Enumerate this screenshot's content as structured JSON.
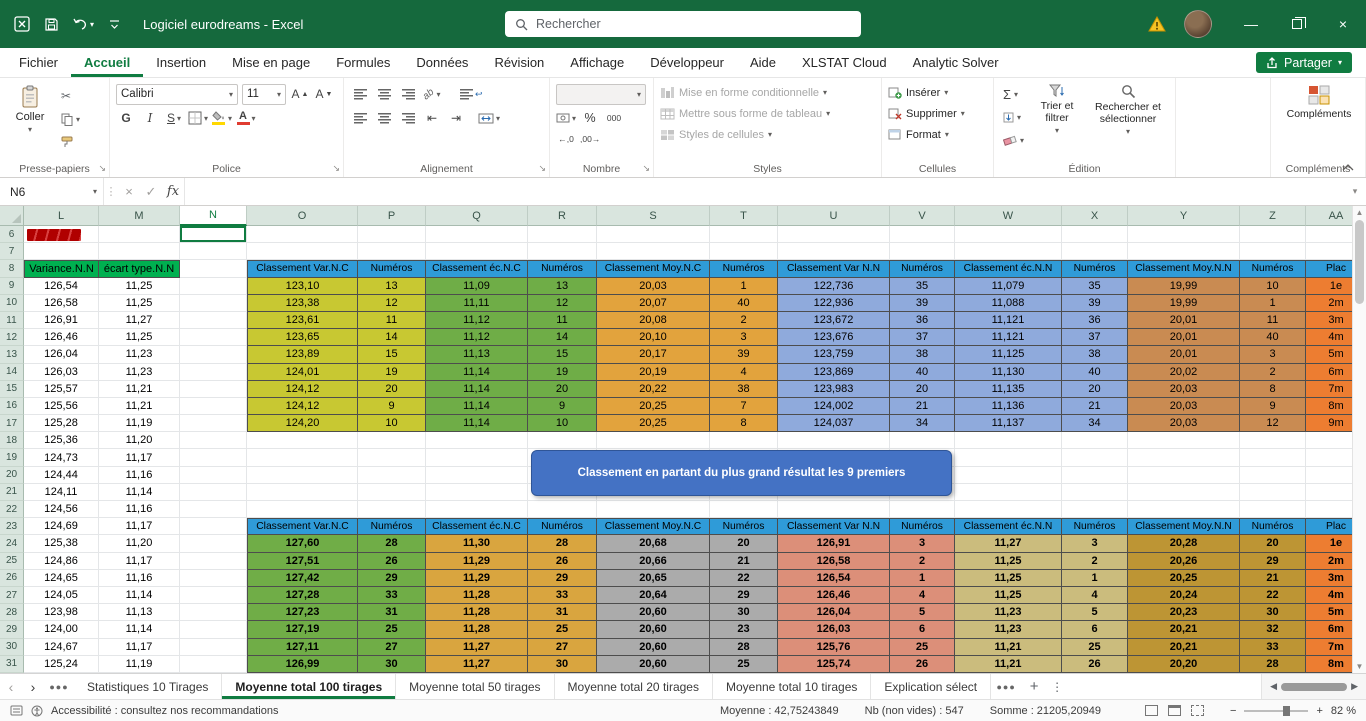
{
  "colors": {
    "titlebar": "#15693D",
    "accent": "#107C41",
    "hdr": "#D9E5DE",
    "header_blue": "#2F9BD8",
    "lm_green": "#00B050",
    "banner": "#4472C4",
    "banner_border": "#2F5597"
  },
  "title_bar": {
    "title": "Logiciel eurodreams -  Excel",
    "search_placeholder": "Rechercher"
  },
  "ribbon_tabs": [
    "Fichier",
    "Accueil",
    "Insertion",
    "Mise en page",
    "Formules",
    "Données",
    "Révision",
    "Affichage",
    "Développeur",
    "Aide",
    "XLSTAT Cloud",
    "Analytic Solver"
  ],
  "active_tab_index": 1,
  "share_label": "Partager",
  "ribbon": {
    "paste_label": "Coller",
    "font_name": "Calibri",
    "font_size": "11",
    "bold_label": "G",
    "italic_label": "I",
    "underline_label": "S",
    "percent_label": "%",
    "thousands_label": "000",
    "dec_inc_label": "←,0",
    "dec_dec_label": ",00→",
    "styles_items": [
      "Mise en forme conditionnelle",
      "Mettre sous forme de tableau",
      "Styles de cellules"
    ],
    "cells_items": [
      "Insérer",
      "Supprimer",
      "Format"
    ],
    "sort_filter_label": "Trier et filtrer",
    "find_select_label": "Rechercher et sélectionner",
    "addins_label": "Compléments",
    "groups": [
      "Presse-papiers",
      "Police",
      "Alignement",
      "Nombre",
      "Styles",
      "Cellules",
      "Édition",
      "Compléments"
    ]
  },
  "formula_bar": {
    "name_box": "N6",
    "fx": "fx",
    "content": ""
  },
  "sheet": {
    "columns": [
      "L",
      "M",
      "N",
      "O",
      "P",
      "Q",
      "R",
      "S",
      "T",
      "U",
      "V",
      "W",
      "X",
      "Y",
      "Z",
      "AA"
    ],
    "first_row": 6,
    "last_row": 31,
    "selected": {
      "row": 6,
      "col": "N"
    },
    "lm_header": [
      "Variance.N.N",
      "écart type.N.N"
    ],
    "lm_rows": {
      "9": [
        "126,54",
        "11,25"
      ],
      "10": [
        "126,58",
        "11,25"
      ],
      "11": [
        "126,91",
        "11,27"
      ],
      "12": [
        "126,46",
        "11,25"
      ],
      "13": [
        "126,04",
        "11,23"
      ],
      "14": [
        "126,03",
        "11,23"
      ],
      "15": [
        "125,57",
        "11,21"
      ],
      "16": [
        "125,56",
        "11,21"
      ],
      "17": [
        "125,28",
        "11,19"
      ],
      "18": [
        "125,36",
        "11,20"
      ],
      "19": [
        "124,73",
        "11,17"
      ],
      "20": [
        "124,44",
        "11,16"
      ],
      "21": [
        "124,11",
        "11,14"
      ],
      "22": [
        "124,56",
        "11,16"
      ],
      "23": [
        "124,69",
        "11,17"
      ],
      "24": [
        "125,38",
        "11,20"
      ],
      "25": [
        "124,86",
        "11,17"
      ],
      "26": [
        "124,65",
        "11,16"
      ],
      "27": [
        "124,05",
        "11,14"
      ],
      "28": [
        "123,98",
        "11,13"
      ],
      "29": [
        "124,00",
        "11,14"
      ],
      "30": [
        "124,67",
        "11,17"
      ],
      "31": [
        "125,24",
        "11,19"
      ]
    },
    "block_headers": [
      "Classement Var.N.C",
      "Numéros",
      "Classement éc.N.C",
      "Numéros",
      "Classement Moy.N.C",
      "Numéros",
      "Classement Var N.N",
      "Numéros",
      "Classement éc.N.N",
      "Numéros",
      "Classement Moy.N.N",
      "Numéros",
      "Plac"
    ],
    "block1": {
      "header_row": 8,
      "bold": false,
      "col_bgs": {
        "O": "#C8C832",
        "P": "#C8C832",
        "Q": "#6FAD47",
        "R": "#6FAD47",
        "S": "#E2A33D",
        "T": "#E2A33D",
        "U": "#8FAADC",
        "V": "#8FAADC",
        "W": "#8FAADC",
        "X": "#8FAADC",
        "Y": "#C98B52",
        "Z": "#C98B52",
        "AA": "#ED7D31"
      },
      "rows": {
        "9": [
          "123,10",
          "13",
          "11,09",
          "13",
          "20,03",
          "1",
          "122,736",
          "35",
          "11,079",
          "35",
          "19,99",
          "10",
          "1e"
        ],
        "10": [
          "123,38",
          "12",
          "11,11",
          "12",
          "20,07",
          "40",
          "122,936",
          "39",
          "11,088",
          "39",
          "19,99",
          "1",
          "2m"
        ],
        "11": [
          "123,61",
          "11",
          "11,12",
          "11",
          "20,08",
          "2",
          "123,672",
          "36",
          "11,121",
          "36",
          "20,01",
          "11",
          "3m"
        ],
        "12": [
          "123,65",
          "14",
          "11,12",
          "14",
          "20,10",
          "3",
          "123,676",
          "37",
          "11,121",
          "37",
          "20,01",
          "40",
          "4m"
        ],
        "13": [
          "123,89",
          "15",
          "11,13",
          "15",
          "20,17",
          "39",
          "123,759",
          "38",
          "11,125",
          "38",
          "20,01",
          "3",
          "5m"
        ],
        "14": [
          "124,01",
          "19",
          "11,14",
          "19",
          "20,19",
          "4",
          "123,869",
          "40",
          "11,130",
          "40",
          "20,02",
          "2",
          "6m"
        ],
        "15": [
          "124,12",
          "20",
          "11,14",
          "20",
          "20,22",
          "38",
          "123,983",
          "20",
          "11,135",
          "20",
          "20,03",
          "8",
          "7m"
        ],
        "16": [
          "124,12",
          "9",
          "11,14",
          "9",
          "20,25",
          "7",
          "124,002",
          "21",
          "11,136",
          "21",
          "20,03",
          "9",
          "8m"
        ],
        "17": [
          "124,20",
          "10",
          "11,14",
          "10",
          "20,25",
          "8",
          "124,037",
          "34",
          "11,137",
          "34",
          "20,03",
          "12",
          "9m"
        ]
      }
    },
    "block2": {
      "header_row": 23,
      "bold": true,
      "col_bgs": {
        "O": "#70AD47",
        "P": "#70AD47",
        "Q": "#D9A53F",
        "R": "#D9A53F",
        "S": "#ABABAB",
        "T": "#ABABAB",
        "U": "#DC8F79",
        "V": "#DC8F79",
        "W": "#CBBC7D",
        "X": "#CBBC7D",
        "Y": "#BD9534",
        "Z": "#BD9534",
        "AA": "#ED7D31"
      },
      "rows": {
        "24": [
          "127,60",
          "28",
          "11,30",
          "28",
          "20,68",
          "20",
          "126,91",
          "3",
          "11,27",
          "3",
          "20,28",
          "20",
          "1e"
        ],
        "25": [
          "127,51",
          "26",
          "11,29",
          "26",
          "20,66",
          "21",
          "126,58",
          "2",
          "11,25",
          "2",
          "20,26",
          "29",
          "2m"
        ],
        "26": [
          "127,42",
          "29",
          "11,29",
          "29",
          "20,65",
          "22",
          "126,54",
          "1",
          "11,25",
          "1",
          "20,25",
          "21",
          "3m"
        ],
        "27": [
          "127,28",
          "33",
          "11,28",
          "33",
          "20,64",
          "29",
          "126,46",
          "4",
          "11,25",
          "4",
          "20,24",
          "22",
          "4m"
        ],
        "28": [
          "127,23",
          "31",
          "11,28",
          "31",
          "20,60",
          "30",
          "126,04",
          "5",
          "11,23",
          "5",
          "20,23",
          "30",
          "5m"
        ],
        "29": [
          "127,19",
          "25",
          "11,28",
          "25",
          "20,60",
          "23",
          "126,03",
          "6",
          "11,23",
          "6",
          "20,21",
          "32",
          "6m"
        ],
        "30": [
          "127,11",
          "27",
          "11,27",
          "27",
          "20,60",
          "28",
          "125,76",
          "25",
          "11,21",
          "25",
          "20,21",
          "33",
          "7m"
        ],
        "31": [
          "126,99",
          "30",
          "11,27",
          "30",
          "20,60",
          "25",
          "125,74",
          "26",
          "11,21",
          "26",
          "20,20",
          "28",
          "8m"
        ]
      }
    },
    "banner": "Classement en partant du plus grand résultat les 9 premiers"
  },
  "sheet_tabs": {
    "tabs": [
      "Statistiques 10 Tirages",
      "Moyenne total 100 tirages",
      "Moyenne total 50 tirages",
      "Moyenne total 20 tirages",
      "Moyenne total 10 tirages",
      "Explication sélect"
    ],
    "active": "Moyenne total 100 tirages"
  },
  "status_bar": {
    "accessibility": "Accessibilité : consultez nos recommandations",
    "average": "Moyenne : 42,75243849",
    "count": "Nb (non vides) : 547",
    "sum": "Somme : 21205,20949",
    "zoom": "82 %"
  }
}
